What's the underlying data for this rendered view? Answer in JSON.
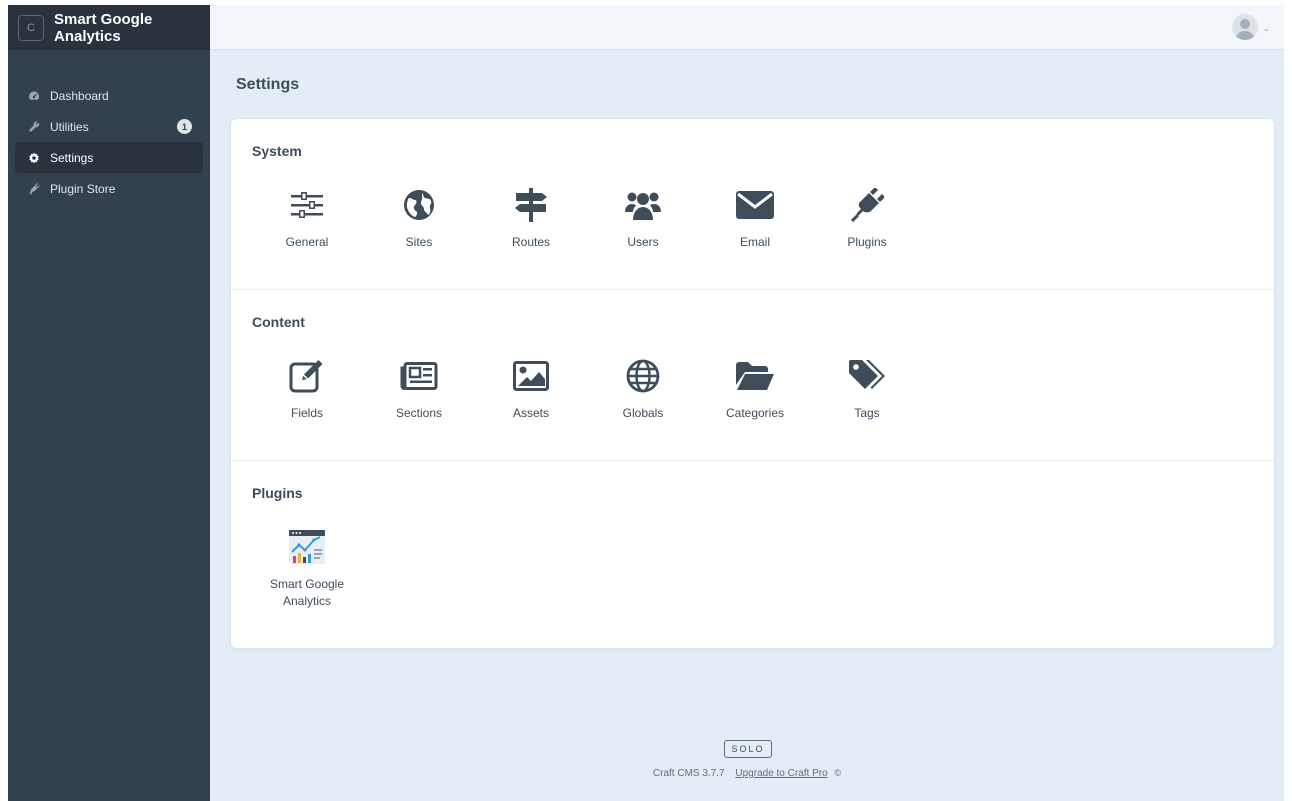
{
  "sidebar": {
    "logo_letter": "C",
    "site_name": "Smart Google Analytics",
    "items": [
      {
        "label": "Dashboard",
        "icon": "gauge-icon"
      },
      {
        "label": "Utilities",
        "icon": "wrench-icon",
        "badge": "1"
      },
      {
        "label": "Settings",
        "icon": "gear-icon",
        "active": true
      },
      {
        "label": "Plugin Store",
        "icon": "plug-icon"
      }
    ]
  },
  "header": {
    "avatar_icon": "user-avatar-icon",
    "caret": "⌄"
  },
  "page": {
    "title": "Settings"
  },
  "sections": [
    {
      "title": "System",
      "tiles": [
        {
          "label": "General",
          "icon": "sliders-icon"
        },
        {
          "label": "Sites",
          "icon": "globe-icon"
        },
        {
          "label": "Routes",
          "icon": "signpost-icon"
        },
        {
          "label": "Users",
          "icon": "users-icon"
        },
        {
          "label": "Email",
          "icon": "envelope-icon"
        },
        {
          "label": "Plugins",
          "icon": "plug-icon"
        }
      ]
    },
    {
      "title": "Content",
      "tiles": [
        {
          "label": "Fields",
          "icon": "edit-icon"
        },
        {
          "label": "Sections",
          "icon": "newspaper-icon"
        },
        {
          "label": "Assets",
          "icon": "image-icon"
        },
        {
          "label": "Globals",
          "icon": "globe-grid-icon"
        },
        {
          "label": "Categories",
          "icon": "folder-open-icon"
        },
        {
          "label": "Tags",
          "icon": "tags-icon"
        }
      ]
    },
    {
      "title": "Plugins",
      "tiles": [
        {
          "label": "Smart Google Analytics",
          "icon": "analytics-chart-icon"
        }
      ]
    }
  ],
  "footer": {
    "edition": "SOLO",
    "version": "Craft CMS 3.7.7",
    "upgrade_link": "Upgrade to Craft Pro",
    "upgrade_icon": "©"
  },
  "colors": {
    "sidebar_bg": "#33404d",
    "sidebar_header_bg": "#29323d",
    "main_bg": "#e4edf6",
    "text": "#3f4d5a"
  }
}
